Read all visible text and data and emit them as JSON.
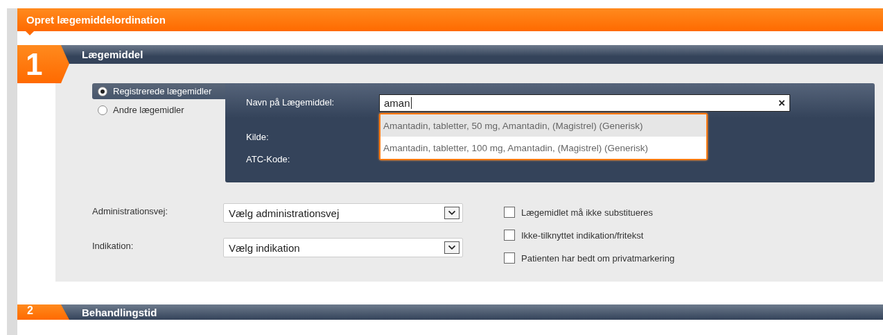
{
  "page_header": {
    "title": "Opret lægemiddelordination"
  },
  "sections": [
    {
      "number": "1",
      "title": "Lægemiddel"
    },
    {
      "number": "2",
      "title": "Behandlingstid"
    }
  ],
  "drug_source": [
    {
      "label": "Registrerede lægemidler",
      "selected": true
    },
    {
      "label": "Andre lægemidler",
      "selected": false
    }
  ],
  "drug_panel": {
    "name_label": "Navn på Lægemiddel:",
    "name_value": "aman",
    "clear_icon": "×",
    "source_label": "Kilde:",
    "atc_label": "ATC-Kode:",
    "suggestions": [
      {
        "text": "Amantadin, tabletter, 50 mg, Amantadin, (Magistrel) (Generisk)",
        "selected": true
      },
      {
        "text": "Amantadin, tabletter, 100 mg, Amantadin, (Magistrel) (Generisk)",
        "selected": false
      }
    ]
  },
  "selects": [
    {
      "label": "Administrationsvej:",
      "value": "Vælg administrationsvej"
    },
    {
      "label": "Indikation:",
      "value": "Vælg indikation"
    }
  ],
  "checkboxes": [
    {
      "label": "Lægemidlet må ikke substitueres",
      "checked": false
    },
    {
      "label": "Ikke-tilknyttet indikation/fritekst",
      "checked": false
    },
    {
      "label": "Patienten har bedt om privatmarkering",
      "checked": false
    }
  ]
}
